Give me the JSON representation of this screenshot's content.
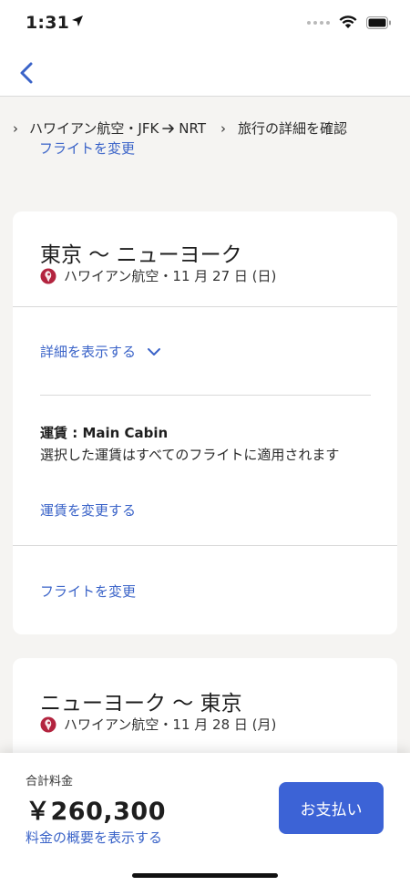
{
  "status_bar": {
    "time": "1:31"
  },
  "breadcrumb": {
    "airline_route": "ハワイアン航空・JFK",
    "destination": "NRT",
    "step": "旅行の詳細を確認",
    "change_flight": "フライトを変更"
  },
  "card1": {
    "title": "東京 〜 ニューヨーク",
    "subtitle": "ハワイアン航空・11 月 27 日 (日)",
    "show_details": "詳細を表示する",
    "fare_prefix": "運賃 : ",
    "fare_class": "Main Cabin",
    "fare_note": "選択した運賃はすべてのフライトに適用されます",
    "change_fare": "運賃を変更する",
    "change_flight": "フライトを変更"
  },
  "card2": {
    "title": "ニューヨーク 〜 東京",
    "subtitle": "ハワイアン航空・11 月 28 日 (月)"
  },
  "bottom_bar": {
    "total_label": "合計料金",
    "total_price": "￥260,300",
    "summary_link": "料金の概要を表示する",
    "pay_button": "お支払い"
  },
  "colors": {
    "link": "#3a63c8",
    "primary_button": "#3c63d6",
    "airline_logo": "#b3243f"
  },
  "icons": [
    "location-arrow-icon",
    "signal-icon",
    "wifi-icon",
    "battery-icon",
    "back-chevron-icon",
    "chevron-right-icon",
    "arrow-right-icon",
    "airline-logo-icon",
    "chevron-down-icon"
  ]
}
